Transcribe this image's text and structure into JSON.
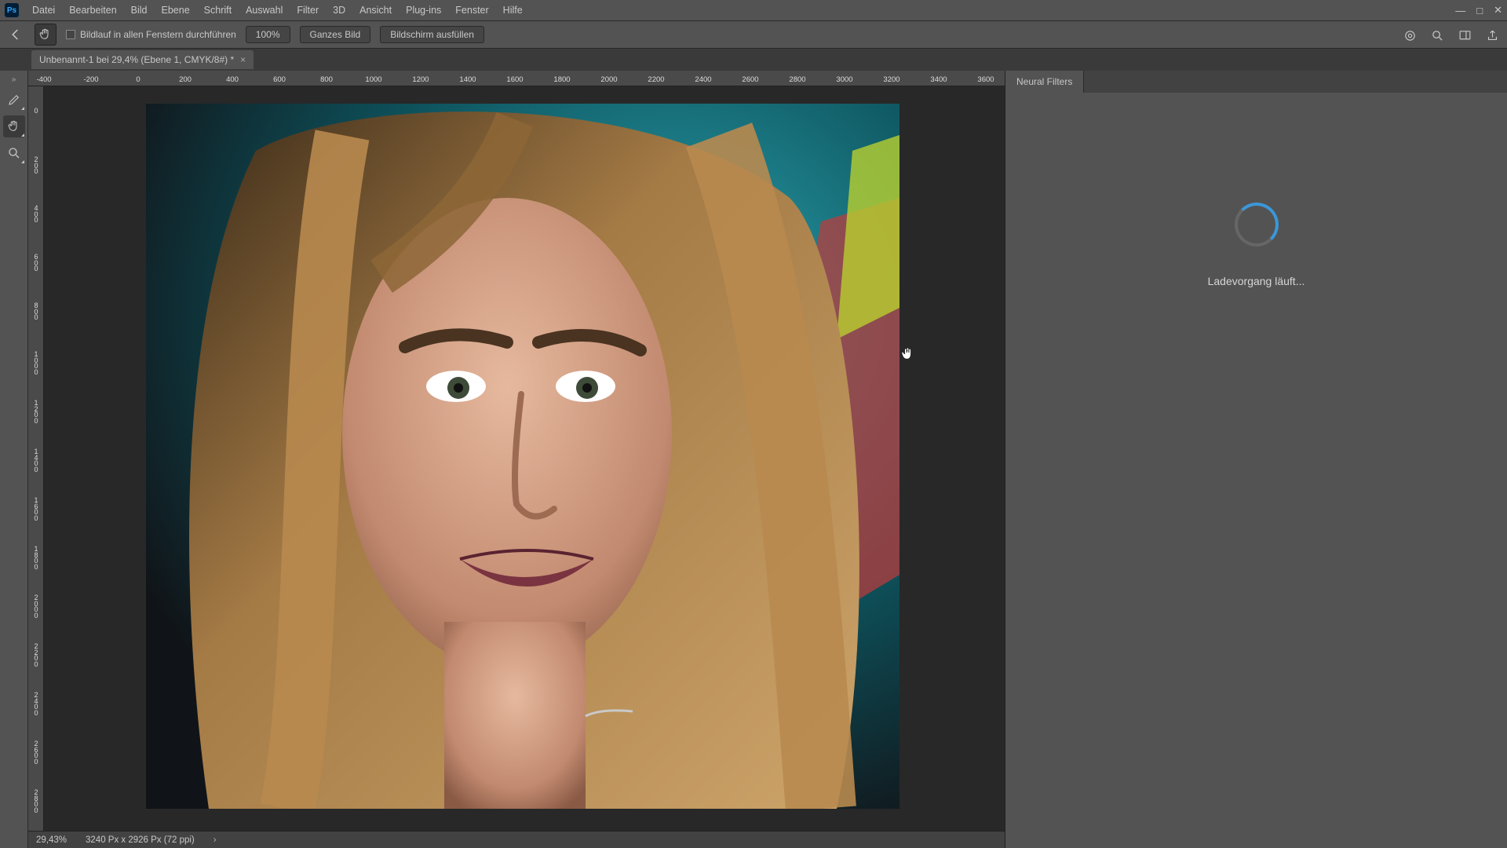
{
  "app_icon_label": "Ps",
  "menu": {
    "items": [
      "Datei",
      "Bearbeiten",
      "Bild",
      "Ebene",
      "Schrift",
      "Auswahl",
      "Filter",
      "3D",
      "Ansicht",
      "Plug-ins",
      "Fenster",
      "Hilfe"
    ]
  },
  "window_controls": {
    "min": "—",
    "max": "□",
    "close": "✕"
  },
  "options": {
    "scroll_all_label": "Bildlauf in allen Fenstern durchführen",
    "percent": "100%",
    "fit_label": "Ganzes Bild",
    "fill_screen_label": "Bildschirm ausfüllen"
  },
  "doctab": {
    "title": "Unbenannt-1 bei 29,4% (Ebene 1, CMYK/8#) *"
  },
  "tools": {
    "edit": "edit-tool",
    "hand": "hand-tool",
    "zoom": "zoom-tool"
  },
  "ruler_h": [
    "-400",
    "-200",
    "0",
    "200",
    "400",
    "600",
    "800",
    "1000",
    "1200",
    "1400",
    "1600",
    "1800",
    "2000",
    "2200",
    "2400",
    "2600",
    "2800",
    "3000",
    "3200",
    "3400",
    "3600"
  ],
  "ruler_v": [
    "0",
    "200",
    "400",
    "600",
    "800",
    "1000",
    "1200",
    "1400",
    "1600",
    "1800",
    "2000",
    "2200",
    "2400",
    "2600",
    "2800"
  ],
  "status": {
    "zoom": "29,43%",
    "dims": "3240 Px x 2926 Px (72 ppi)"
  },
  "panel": {
    "tab": "Neural Filters",
    "loading": "Ladevorgang läuft..."
  }
}
